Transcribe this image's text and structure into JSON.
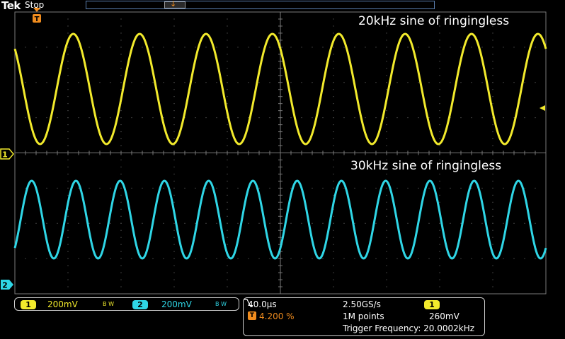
{
  "header": {
    "brand": "Tek",
    "run_state": "Stop",
    "trigger_position_marker": "T"
  },
  "waveforms": {
    "ch1": {
      "label": "20kHz sine of ringingless",
      "color": "#f2ea2c",
      "frequency_hz": 20000
    },
    "ch2": {
      "label": "30kHz sine of ringingless",
      "color": "#2fd6e6",
      "frequency_hz": 30000
    }
  },
  "markers": {
    "ch1_ground": "1",
    "ch2_ground": "2",
    "trigger_level_icon": "arrow-left-icon"
  },
  "channels": [
    {
      "badge": "1",
      "scale": "200mV",
      "bw": "B W",
      "color": "#f2ea2c"
    },
    {
      "badge": "2",
      "scale": "200mV",
      "bw": "B W",
      "color": "#2fd6e6"
    }
  ],
  "horizontal": {
    "time_per_div": "40.0µs",
    "sample_rate": "2.50GS/s",
    "trigger_badge": "1",
    "trigger_slope_icon": "falling-edge-icon",
    "trigger_pos_icon": "T",
    "trigger_pos": "4.200 %",
    "record_length": "1M points",
    "trigger_level": "260mV",
    "trigger_frequency": "Trigger Frequency: 20.0002kHz"
  },
  "colors": {
    "ch1": "#f2ea2c",
    "ch2": "#2fd6e6",
    "trigger": "#f08c1e",
    "graticule": "#7a7a7a"
  }
}
